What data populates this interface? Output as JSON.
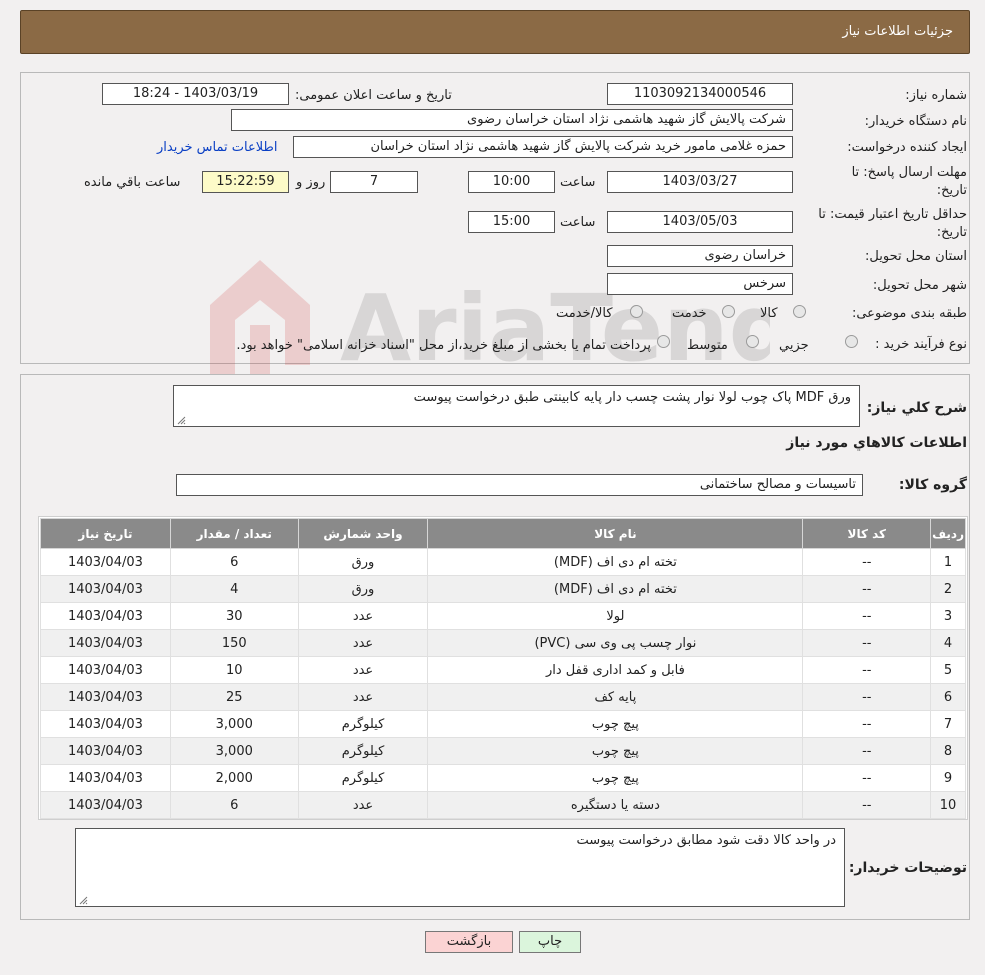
{
  "header": {
    "title": "جزئیات اطلاعات نیاز"
  },
  "form": {
    "need_number_label": "شماره نیاز:",
    "need_number": "1103092134000546",
    "announce_label": "تاریخ و ساعت اعلان عمومی:",
    "announce_value": "1403/03/19 - 18:24",
    "buyer_org_label": "نام دستگاه خریدار:",
    "buyer_org": "شرکت پالایش گاز شهید هاشمی نژاد   استان خراسان رضوی",
    "creator_label": "ایجاد کننده درخواست:",
    "creator": "حمزه غلامی مامور خرید شرکت پالایش گاز شهید هاشمی نژاد   استان خراسان",
    "contact_link": "اطلاعات تماس خریدار",
    "deadline_label": "مهلت ارسال پاسخ: تا",
    "deadline_label2": "تاریخ:",
    "deadline_date": "1403/03/27",
    "time_label": "ساعت",
    "deadline_time": "10:00",
    "days_value": "7",
    "days_label": "روز و",
    "remaining_time": "15:22:59",
    "remaining_label": "ساعت باقي مانده",
    "validity_label": "حداقل تاريخ اعتبار قيمت: تا",
    "validity_label2": "تاريخ:",
    "validity_date": "1403/05/03",
    "validity_time": "15:00",
    "province_label": "استان محل تحویل:",
    "province": "خراسان رضوی",
    "city_label": "شهر محل تحویل:",
    "city": "سرخس",
    "category_label": "طبقه بندی موضوعی:",
    "category_options": [
      "کالا",
      "خدمت",
      "کالا/خدمت"
    ],
    "process_label": "نوع فرآیند خرید :",
    "process_options": [
      "جزیي",
      "متوسط"
    ],
    "process_note": "پرداخت تمام یا بخشی از مبلغ خرید،از محل \"اسناد خزانه اسلامی\" خواهد بود."
  },
  "details": {
    "summary_label": "شرح کلي نياز:",
    "summary": "ورق MDF پاک چوب لولا نوار پشت چسب دار پایه کابینتی طبق درخواست پیوست",
    "goods_info_title": "اطلاعات کالاهاي مورد نياز",
    "group_label": "گروه کالا:",
    "group_value": "تاسیسات و مصالح ساختمانی",
    "table": {
      "headers": [
        "ردیف",
        "کد کالا",
        "نام کالا",
        "واحد شمارش",
        "تعداد / مقدار",
        "تاریخ نیاز"
      ],
      "rows": [
        [
          "1",
          "--",
          "تخته ام دی اف (MDF)",
          "ورق",
          "6",
          "1403/04/03"
        ],
        [
          "2",
          "--",
          "تخته ام دی اف (MDF)",
          "ورق",
          "4",
          "1403/04/03"
        ],
        [
          "3",
          "--",
          "لولا",
          "عدد",
          "30",
          "1403/04/03"
        ],
        [
          "4",
          "--",
          "نوار چسب پی وی سی (PVC)",
          "عدد",
          "150",
          "1403/04/03"
        ],
        [
          "5",
          "--",
          "فابل و کمد اداری قفل دار",
          "عدد",
          "10",
          "1403/04/03"
        ],
        [
          "6",
          "--",
          "پایه کف",
          "عدد",
          "25",
          "1403/04/03"
        ],
        [
          "7",
          "--",
          "پیچ چوب",
          "کیلوگرم",
          "3,000",
          "1403/04/03"
        ],
        [
          "8",
          "--",
          "پیچ چوب",
          "کیلوگرم",
          "3,000",
          "1403/04/03"
        ],
        [
          "9",
          "--",
          "پیچ چوب",
          "کیلوگرم",
          "2,000",
          "1403/04/03"
        ],
        [
          "10",
          "--",
          "دسته یا دستگیره",
          "عدد",
          "6",
          "1403/04/03"
        ]
      ]
    },
    "buyer_notes_label": "توضیحات خریدار:",
    "buyer_notes": "در واحد کالا دقت شود مطابق درخواست پیوست"
  },
  "buttons": {
    "print": "چاپ",
    "back": "بازگشت"
  },
  "colors": {
    "header_bg": "#8b6a45",
    "table_header_bg": "#8a8a8a",
    "back_button_bg": "#fbd3d3",
    "print_button_bg": "#dbf5dc",
    "timer_bg": "#fdfbc8"
  }
}
